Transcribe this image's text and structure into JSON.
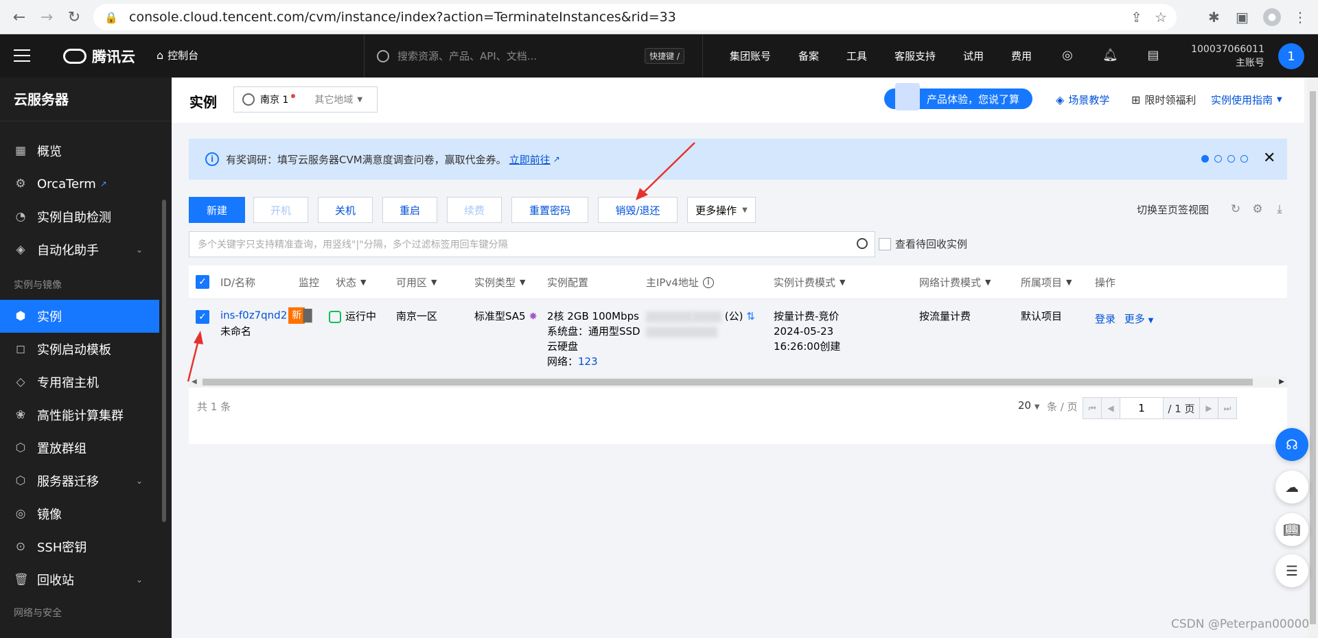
{
  "browser": {
    "url": "console.cloud.tencent.com/cvm/instance/index?action=TerminateInstances&rid=33"
  },
  "topnav": {
    "brand": "腾讯云",
    "console": "控制台",
    "search_placeholder": "搜索资源、产品、API、文档...",
    "shortcut": "快捷键 /",
    "menu": [
      "集团账号",
      "备案",
      "工具",
      "客服支持",
      "试用",
      "费用"
    ],
    "account_id": "100037066011",
    "account_role": "主账号",
    "avatar": "1"
  },
  "sidebar": {
    "title": "云服务器",
    "items": [
      {
        "label": "概览",
        "icon": "grid-icon"
      },
      {
        "label": "OrcaTerm",
        "icon": "terminal-icon"
      },
      {
        "label": "实例自助检测",
        "icon": "gauge-icon"
      },
      {
        "label": "自动化助手",
        "icon": "robot-icon"
      },
      {
        "label": "实例",
        "icon": "cube-icon"
      },
      {
        "label": "实例启动模板",
        "icon": "template-icon"
      },
      {
        "label": "专用宿主机",
        "icon": "layers-icon"
      },
      {
        "label": "高性能计算集群",
        "icon": "cluster-icon"
      },
      {
        "label": "置放群组",
        "icon": "placement-icon"
      },
      {
        "label": "服务器迁移",
        "icon": "migrate-icon"
      },
      {
        "label": "镜像",
        "icon": "disc-icon"
      },
      {
        "label": "SSH密钥",
        "icon": "key-icon"
      },
      {
        "label": "回收站",
        "icon": "trash-icon"
      }
    ],
    "group_instances": "实例与镜像",
    "group_network": "网络与安全"
  },
  "page": {
    "title": "实例",
    "region": "南京 1",
    "other_region": "其它地域",
    "feedback": "产品体验，您说了算",
    "scene_tutorial": "场景教学",
    "limited_benefit": "限时领福利",
    "guide": "实例使用指南"
  },
  "notice": {
    "text": "有奖调研：填写云服务器CVM满意度调查问卷，赢取代金券。",
    "link": "立即前往"
  },
  "toolbar": {
    "buttons": [
      "新建",
      "开机",
      "关机",
      "重启",
      "续费",
      "重置密码",
      "销毁/退还",
      "更多操作"
    ],
    "switch_view": "切换至页签视图"
  },
  "search": {
    "placeholder": "多个关键字只支持精准查询，用竖线\"|\"分隔，多个过滤标签用回车键分隔",
    "recycle": "查看待回收实例"
  },
  "table": {
    "headers": [
      "ID/名称",
      "监控",
      "状态",
      "可用区",
      "实例类型",
      "实例配置",
      "主IPv4地址",
      "实例计费模式",
      "网络计费模式",
      "所属项目",
      "操作"
    ],
    "row": {
      "id": "ins-f0z7qnd2",
      "new_badge": "新",
      "name": "未命名",
      "status": "运行中",
      "zone": "南京一区",
      "type": "标准型SA5",
      "config_line1": "2核 2GB 100Mbps",
      "config_line2": "系统盘：通用型SSD",
      "config_line3": "云硬盘",
      "network_label": "网络：",
      "network_value": "123",
      "ip_public_suffix": "(公)",
      "billing": "按量计费-竞价",
      "created_date": "2024-05-23",
      "created_time": "16:26:00创建",
      "net_billing": "按流量计费",
      "project": "默认项目",
      "login": "登录",
      "more": "更多"
    },
    "total": "共 1 条",
    "page_size": "20",
    "per_page": "条 / 页",
    "page_num": "1",
    "page_total": "/ 1 页"
  },
  "watermark": "CSDN @Peterpan00000"
}
